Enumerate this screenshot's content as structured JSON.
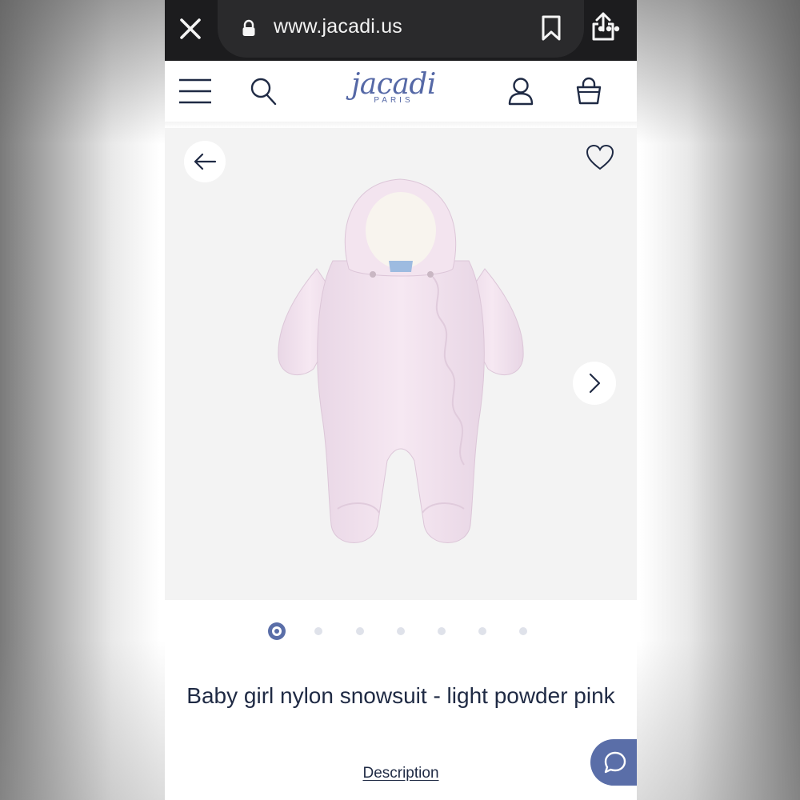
{
  "browser": {
    "url": "www.jacadi.us",
    "icons": [
      "close-icon",
      "lock-icon",
      "bookmark-icon",
      "share-icon",
      "more-icon"
    ]
  },
  "header": {
    "logo_main": "jacadi",
    "logo_sub": "PARIS",
    "icons": [
      "menu-icon",
      "search-icon",
      "account-icon",
      "shopping-bag-icon"
    ]
  },
  "gallery": {
    "icons": [
      "arrow-left-icon",
      "heart-icon",
      "chevron-right-icon"
    ],
    "image_count": 7,
    "active_index": 0
  },
  "product": {
    "title": "Baby girl nylon snowsuit - light powder pink",
    "description_link": "Description"
  },
  "colors": {
    "brand": "#5a6ea8",
    "browser_bar": "#1c1c1e",
    "gallery_bg": "#f3f3f3",
    "text": "#1f2a44",
    "product_pink": "#f2e3ee"
  }
}
